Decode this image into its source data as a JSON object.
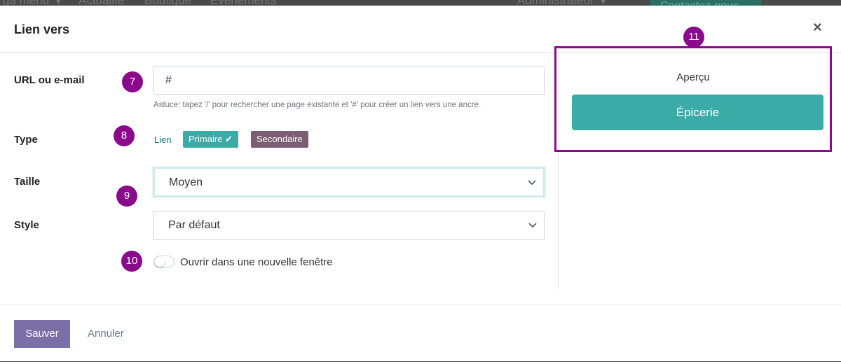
{
  "background": {
    "nav": [
      "ga menu ▼",
      "Actualité",
      "Boutique",
      "Événements"
    ],
    "user": "Administrateur ▼",
    "cta": "Contactez-nous"
  },
  "modal": {
    "title": "Lien vers",
    "close_icon": "close-icon",
    "fields": {
      "url": {
        "label": "URL ou e-mail",
        "value": "#",
        "hint": "Astuce: tapez '/' pour rechercher une page existante et '#' pour créer un lien vers une ancre."
      },
      "type": {
        "label": "Type",
        "options": {
          "link": "Lien",
          "primary": "Primaire",
          "secondary": "Secondaire"
        },
        "selected": "Primaire"
      },
      "size": {
        "label": "Taille",
        "value": "Moyen"
      },
      "style": {
        "label": "Style",
        "value": "Par défaut"
      },
      "new_window": {
        "label": "Ouvrir dans une nouvelle fenêtre",
        "checked": false
      }
    },
    "preview": {
      "title": "Aperçu",
      "button": "Épicerie"
    },
    "footer": {
      "save": "Sauver",
      "cancel": "Annuler"
    }
  },
  "annotations": [
    "7",
    "8",
    "9",
    "10",
    "11"
  ],
  "colors": {
    "accent": "#3aaba7",
    "secondary": "#7b5e74",
    "annotation": "#8b0a8b",
    "save": "#7a6fa7"
  }
}
